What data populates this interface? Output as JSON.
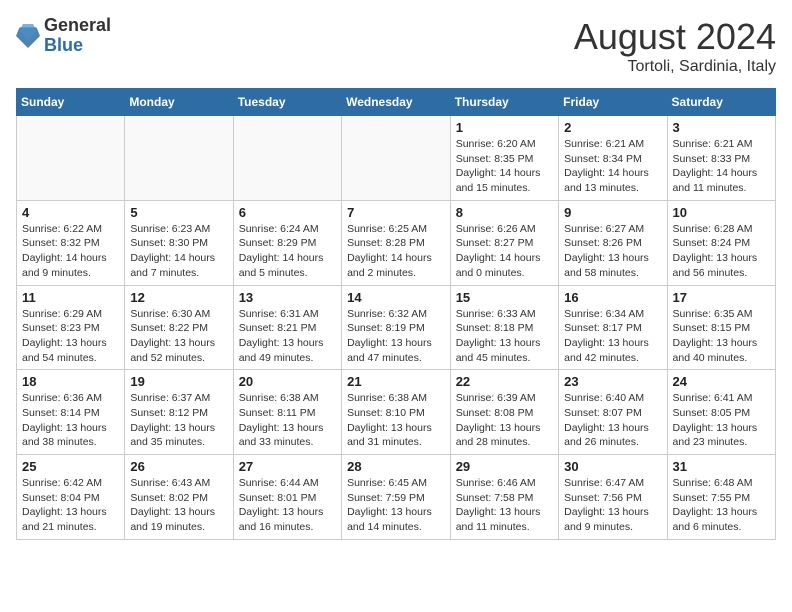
{
  "header": {
    "logo_general": "General",
    "logo_blue": "Blue",
    "month_year": "August 2024",
    "location": "Tortoli, Sardinia, Italy"
  },
  "weekdays": [
    "Sunday",
    "Monday",
    "Tuesday",
    "Wednesday",
    "Thursday",
    "Friday",
    "Saturday"
  ],
  "weeks": [
    [
      {
        "day": "",
        "info": ""
      },
      {
        "day": "",
        "info": ""
      },
      {
        "day": "",
        "info": ""
      },
      {
        "day": "",
        "info": ""
      },
      {
        "day": "1",
        "info": "Sunrise: 6:20 AM\nSunset: 8:35 PM\nDaylight: 14 hours\nand 15 minutes."
      },
      {
        "day": "2",
        "info": "Sunrise: 6:21 AM\nSunset: 8:34 PM\nDaylight: 14 hours\nand 13 minutes."
      },
      {
        "day": "3",
        "info": "Sunrise: 6:21 AM\nSunset: 8:33 PM\nDaylight: 14 hours\nand 11 minutes."
      }
    ],
    [
      {
        "day": "4",
        "info": "Sunrise: 6:22 AM\nSunset: 8:32 PM\nDaylight: 14 hours\nand 9 minutes."
      },
      {
        "day": "5",
        "info": "Sunrise: 6:23 AM\nSunset: 8:30 PM\nDaylight: 14 hours\nand 7 minutes."
      },
      {
        "day": "6",
        "info": "Sunrise: 6:24 AM\nSunset: 8:29 PM\nDaylight: 14 hours\nand 5 minutes."
      },
      {
        "day": "7",
        "info": "Sunrise: 6:25 AM\nSunset: 8:28 PM\nDaylight: 14 hours\nand 2 minutes."
      },
      {
        "day": "8",
        "info": "Sunrise: 6:26 AM\nSunset: 8:27 PM\nDaylight: 14 hours\nand 0 minutes."
      },
      {
        "day": "9",
        "info": "Sunrise: 6:27 AM\nSunset: 8:26 PM\nDaylight: 13 hours\nand 58 minutes."
      },
      {
        "day": "10",
        "info": "Sunrise: 6:28 AM\nSunset: 8:24 PM\nDaylight: 13 hours\nand 56 minutes."
      }
    ],
    [
      {
        "day": "11",
        "info": "Sunrise: 6:29 AM\nSunset: 8:23 PM\nDaylight: 13 hours\nand 54 minutes."
      },
      {
        "day": "12",
        "info": "Sunrise: 6:30 AM\nSunset: 8:22 PM\nDaylight: 13 hours\nand 52 minutes."
      },
      {
        "day": "13",
        "info": "Sunrise: 6:31 AM\nSunset: 8:21 PM\nDaylight: 13 hours\nand 49 minutes."
      },
      {
        "day": "14",
        "info": "Sunrise: 6:32 AM\nSunset: 8:19 PM\nDaylight: 13 hours\nand 47 minutes."
      },
      {
        "day": "15",
        "info": "Sunrise: 6:33 AM\nSunset: 8:18 PM\nDaylight: 13 hours\nand 45 minutes."
      },
      {
        "day": "16",
        "info": "Sunrise: 6:34 AM\nSunset: 8:17 PM\nDaylight: 13 hours\nand 42 minutes."
      },
      {
        "day": "17",
        "info": "Sunrise: 6:35 AM\nSunset: 8:15 PM\nDaylight: 13 hours\nand 40 minutes."
      }
    ],
    [
      {
        "day": "18",
        "info": "Sunrise: 6:36 AM\nSunset: 8:14 PM\nDaylight: 13 hours\nand 38 minutes."
      },
      {
        "day": "19",
        "info": "Sunrise: 6:37 AM\nSunset: 8:12 PM\nDaylight: 13 hours\nand 35 minutes."
      },
      {
        "day": "20",
        "info": "Sunrise: 6:38 AM\nSunset: 8:11 PM\nDaylight: 13 hours\nand 33 minutes."
      },
      {
        "day": "21",
        "info": "Sunrise: 6:38 AM\nSunset: 8:10 PM\nDaylight: 13 hours\nand 31 minutes."
      },
      {
        "day": "22",
        "info": "Sunrise: 6:39 AM\nSunset: 8:08 PM\nDaylight: 13 hours\nand 28 minutes."
      },
      {
        "day": "23",
        "info": "Sunrise: 6:40 AM\nSunset: 8:07 PM\nDaylight: 13 hours\nand 26 minutes."
      },
      {
        "day": "24",
        "info": "Sunrise: 6:41 AM\nSunset: 8:05 PM\nDaylight: 13 hours\nand 23 minutes."
      }
    ],
    [
      {
        "day": "25",
        "info": "Sunrise: 6:42 AM\nSunset: 8:04 PM\nDaylight: 13 hours\nand 21 minutes."
      },
      {
        "day": "26",
        "info": "Sunrise: 6:43 AM\nSunset: 8:02 PM\nDaylight: 13 hours\nand 19 minutes."
      },
      {
        "day": "27",
        "info": "Sunrise: 6:44 AM\nSunset: 8:01 PM\nDaylight: 13 hours\nand 16 minutes."
      },
      {
        "day": "28",
        "info": "Sunrise: 6:45 AM\nSunset: 7:59 PM\nDaylight: 13 hours\nand 14 minutes."
      },
      {
        "day": "29",
        "info": "Sunrise: 6:46 AM\nSunset: 7:58 PM\nDaylight: 13 hours\nand 11 minutes."
      },
      {
        "day": "30",
        "info": "Sunrise: 6:47 AM\nSunset: 7:56 PM\nDaylight: 13 hours\nand 9 minutes."
      },
      {
        "day": "31",
        "info": "Sunrise: 6:48 AM\nSunset: 7:55 PM\nDaylight: 13 hours\nand 6 minutes."
      }
    ]
  ]
}
